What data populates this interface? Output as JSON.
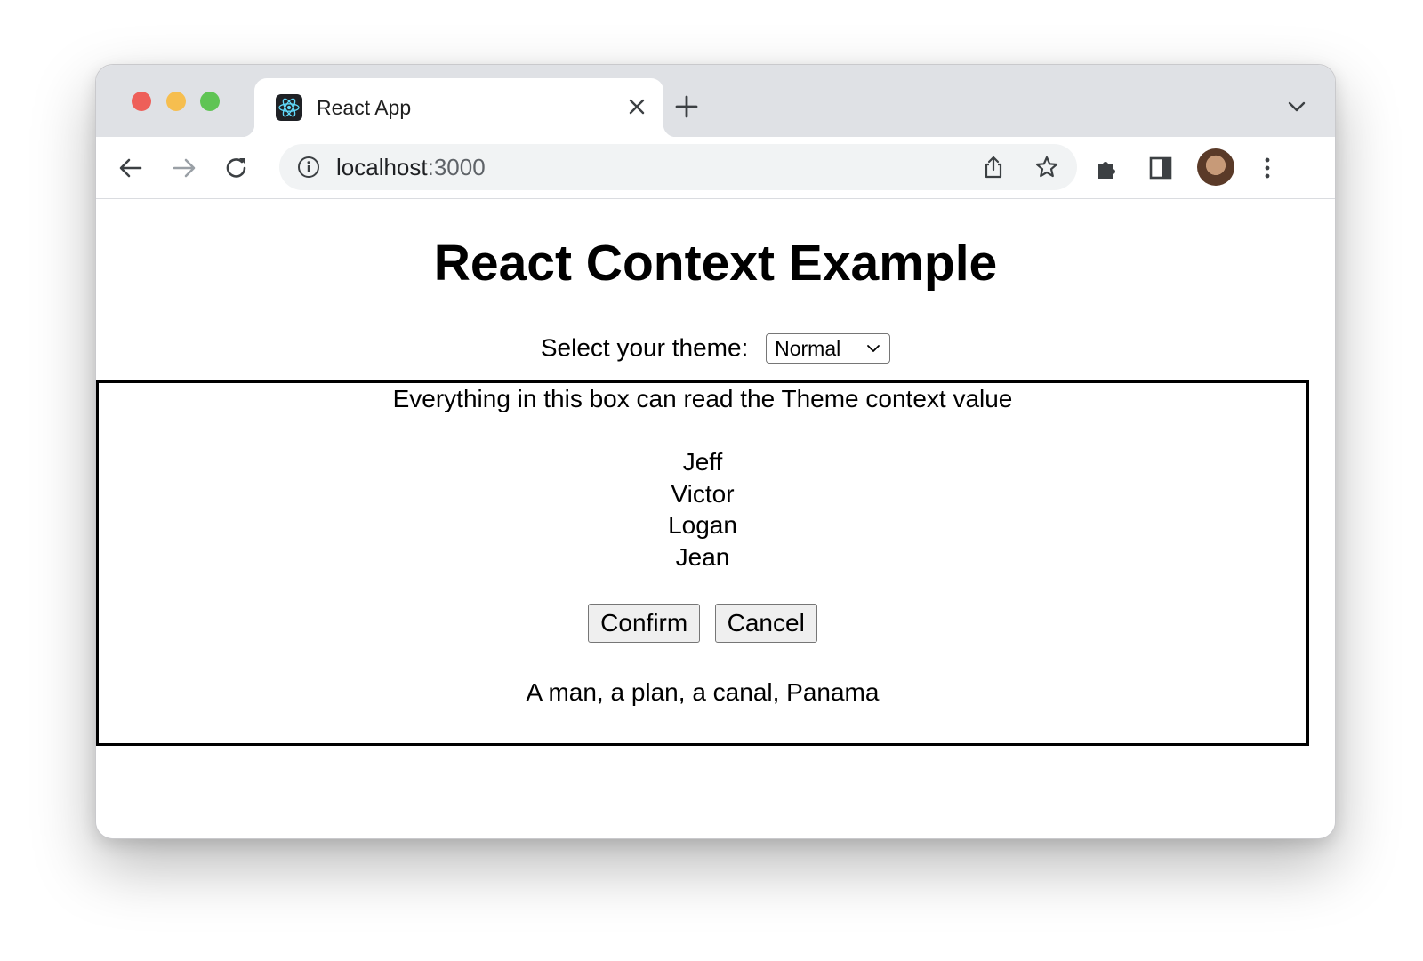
{
  "browser": {
    "tab": {
      "title": "React App",
      "favicon": "react-logo-icon"
    },
    "address": {
      "host": "localhost",
      "port": ":3000"
    },
    "toolbar_icons": [
      "back-icon",
      "forward-icon",
      "reload-icon",
      "info-icon",
      "share-icon",
      "star-icon",
      "extensions-icon",
      "side-panel-icon",
      "profile-avatar",
      "more-icon"
    ],
    "traffic_colors": {
      "close": "#ee5f59",
      "minimize": "#f6be4f",
      "maximize": "#5fc454"
    }
  },
  "page": {
    "title": "React Context Example",
    "theme_label": "Select your theme:",
    "theme_selected": "Normal",
    "box": {
      "intro": "Everything in this box can read the Theme context value",
      "names": [
        "Jeff",
        "Victor",
        "Logan",
        "Jean"
      ],
      "confirm_label": "Confirm",
      "cancel_label": "Cancel",
      "footer_text": "A man, a plan, a canal, Panama"
    }
  }
}
